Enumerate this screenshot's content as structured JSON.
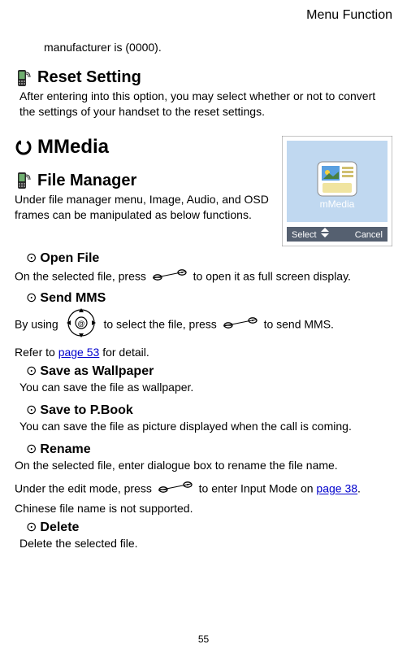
{
  "header": {
    "title": "Menu Function"
  },
  "intro": {
    "manufacturer_line": "manufacturer is (0000)."
  },
  "reset": {
    "heading": "Reset Setting",
    "body": "After entering into this option, you may select whether or not to convert the settings of your handset to the reset settings."
  },
  "mmedia": {
    "heading": "MMedia"
  },
  "phone_preview": {
    "label": "mMedia",
    "softkey_left": "Select",
    "softkey_right": "Cancel"
  },
  "file_manager": {
    "heading": "File Manager",
    "intro": "Under file manager menu, Image, Audio, and OSD frames can be manipulated as below functions.",
    "open_file": {
      "heading": "Open File",
      "pre": "On the selected file, press",
      "post": "to open it as full screen display."
    },
    "send_mms": {
      "heading": "Send MMS",
      "pre": "By using",
      "mid": "to select the file, press",
      "post": "to send MMS.",
      "refer_pre": "Refer to ",
      "refer_link": "page 53",
      "refer_post": " for detail."
    },
    "wallpaper": {
      "heading": "Save as Wallpaper",
      "body": "You can save the file as wallpaper."
    },
    "pbook": {
      "heading": "Save to P.Book",
      "body": "You can save the file as picture displayed when the call is coming."
    },
    "rename": {
      "heading": "Rename",
      "line1": "On the selected file, enter dialogue box to rename the file name.",
      "line2_pre": "Under the edit mode, press",
      "line2_mid": "to enter Input Mode on ",
      "line2_link": "page 38",
      "line2_post": ".   Chinese file name is not supported."
    },
    "delete": {
      "heading": "Delete",
      "body": "Delete the selected file."
    }
  },
  "page_number": "55"
}
